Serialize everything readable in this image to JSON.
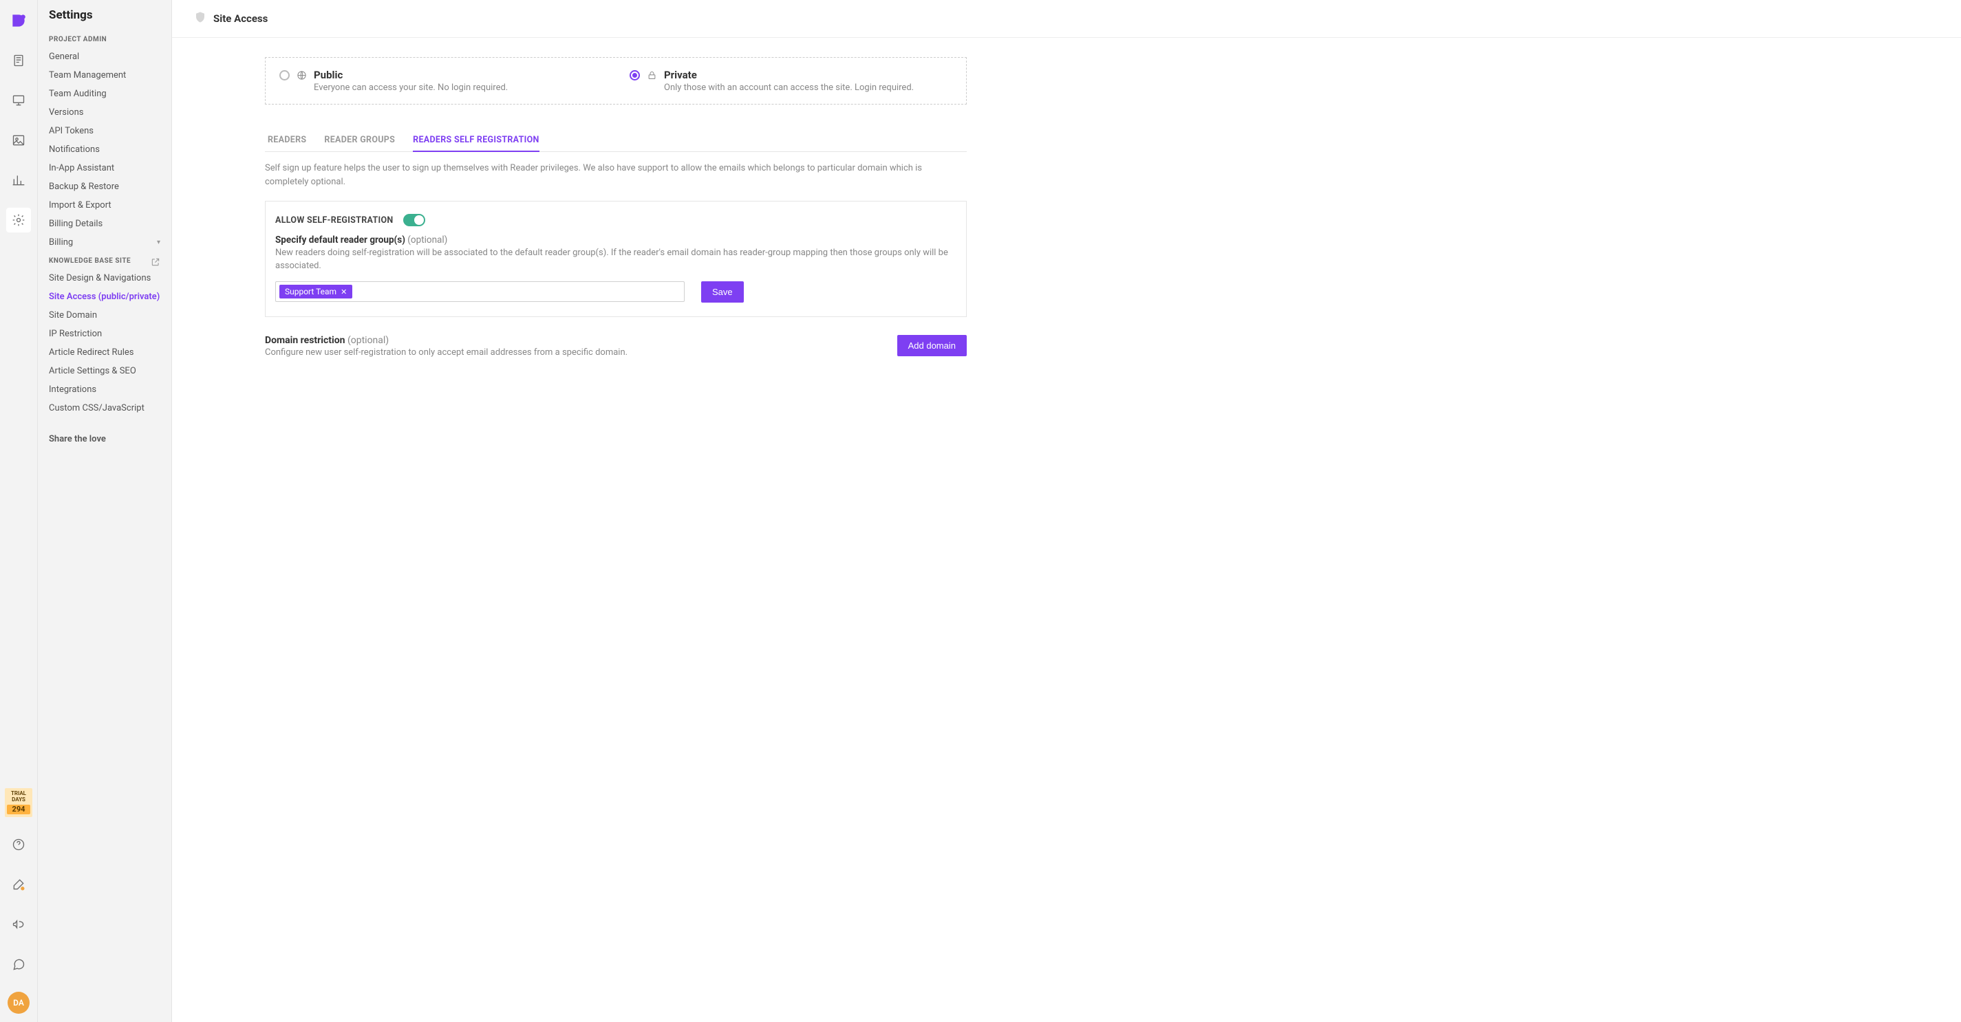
{
  "trial": {
    "line1": "TRIAL",
    "line2": "DAYS",
    "count": "294"
  },
  "avatar": {
    "initials": "DA"
  },
  "sidebar": {
    "title": "Settings",
    "sections": [
      {
        "label": "PROJECT ADMIN",
        "items": [
          "General",
          "Team Management",
          "Team Auditing",
          "Versions",
          "API Tokens",
          "Notifications",
          "In-App Assistant",
          "Backup & Restore",
          "Import & Export",
          "Billing Details",
          "Billing"
        ]
      },
      {
        "label": "KNOWLEDGE BASE SITE",
        "items": [
          "Site Design & Navigations",
          "Site Access (public/private)",
          "Site Domain",
          "IP Restriction",
          "Article Redirect Rules",
          "Article Settings & SEO",
          "Integrations",
          "Custom CSS/JavaScript"
        ]
      }
    ],
    "share": "Share the love"
  },
  "page": {
    "title": "Site Access",
    "access_modes": {
      "public": {
        "title": "Public",
        "desc": "Everyone can access your site. No login required."
      },
      "private": {
        "title": "Private",
        "desc": "Only those with an account can access the site. Login required."
      }
    },
    "tabs": [
      "READERS",
      "READER GROUPS",
      "READERS SELF REGISTRATION"
    ],
    "tab_intro": "Self sign up feature helps the user to sign up themselves with Reader privileges. We also have support to allow the emails which belongs to particular domain which is completely optional.",
    "self_reg": {
      "toggle_label": "ALLOW SELF-REGISTRATION",
      "subhead": "Specify default reader group(s)",
      "optional": "(optional)",
      "subdesc": "New readers doing self-registration will be associated to the default reader group(s). If the reader's email domain has reader-group mapping then those groups only will be associated.",
      "tags": [
        "Support Team"
      ],
      "save": "Save"
    },
    "domain": {
      "title": "Domain restriction",
      "optional": "(optional)",
      "desc": "Configure new user self-registration to only accept email addresses from a specific domain.",
      "add": "Add domain"
    }
  }
}
